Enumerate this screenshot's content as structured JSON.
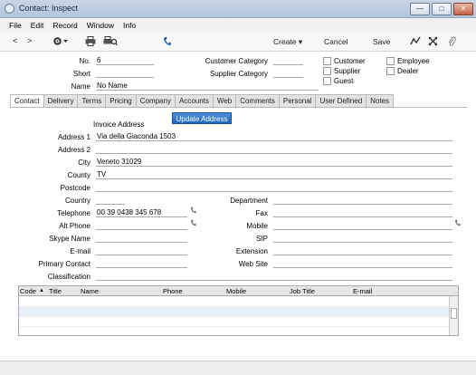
{
  "window": {
    "title": "Contact: Inspect",
    "minimize": "—",
    "maximize": "□",
    "close": "✕"
  },
  "menu": [
    "File",
    "Edit",
    "Record",
    "Window",
    "Info"
  ],
  "toolbar": {
    "prev": "<",
    "next": ">",
    "create_label": "Create",
    "cancel_label": "Cancel",
    "save_label": "Save"
  },
  "header": {
    "no_label": "No.",
    "no_value": "6",
    "short_label": "Short",
    "short_value": "",
    "name_label": "Name",
    "name_value": "No Name",
    "customer_category_label": "Customer Category",
    "customer_category_value": "",
    "supplier_category_label": "Supplier Category",
    "supplier_category_value": "",
    "checkboxes": [
      "Customer",
      "Supplier",
      "Guest",
      "Employee",
      "Dealer"
    ]
  },
  "tabs": [
    "Contact",
    "Delivery",
    "Terms",
    "Pricing",
    "Company",
    "Accounts",
    "Web",
    "Comments",
    "Personal",
    "User Defined",
    "Notes"
  ],
  "contact_tab": {
    "invoice_address_heading": "Invoice Address",
    "update_address_button": "Update Address",
    "address1_label": "Address 1",
    "address1_value": "Via della Giaconda 1503",
    "address2_label": "Address 2",
    "address2_value": "",
    "city_label": "City",
    "city_value": "Veneto 31029",
    "county_label": "County",
    "county_value": "TV",
    "postcode_label": "Postcode",
    "postcode_value": "",
    "country_label": "Country",
    "country_value": "",
    "telephone_label": "Telephone",
    "telephone_value": "00 39 0438 345 678",
    "alt_phone_label": "Alt Phone",
    "alt_phone_value": "",
    "skype_label": "Skype Name",
    "skype_value": "",
    "email_label": "E-mail",
    "email_value": "",
    "primary_contact_label": "Primary Contact",
    "primary_contact_value": "",
    "classification_label": "Classification",
    "classification_value": "",
    "department_label": "Department",
    "department_value": "",
    "fax_label": "Fax",
    "fax_value": "",
    "mobile_label": "Mobile",
    "mobile_value": "",
    "sip_label": "SIP",
    "sip_value": "",
    "extension_label": "Extension",
    "extension_value": "",
    "website_label": "Web Site",
    "website_value": ""
  },
  "grid": {
    "columns": [
      "Code",
      "Title",
      "Name",
      "Phone",
      "Mobile",
      "Job Title",
      "E-mail"
    ],
    "sort_indicator": "▲"
  },
  "icons": {
    "app": "app-icon",
    "settings": "gear-icon",
    "print": "printer-icon",
    "print_preview": "print-preview-icon",
    "call": "phone-icon",
    "chart": "chart-icon",
    "expand": "expand-icon",
    "attach": "paperclip-icon"
  },
  "colors": {
    "accent": "#2a6fc4",
    "titlebar": "#c3d1e3"
  }
}
